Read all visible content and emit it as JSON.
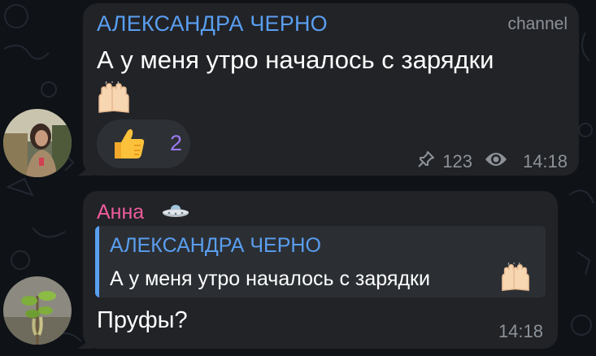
{
  "messages": [
    {
      "author": "АЛЕКСАНДРА ЧЕРНО",
      "tag": "channel",
      "text": "А у меня утро началось с зарядки",
      "emoji": "raising-hands",
      "reaction": {
        "emoji": "thumbs-up",
        "count": "2"
      },
      "views": "123",
      "time": "14:18",
      "pinned": true,
      "avatar": "avatar-woman"
    },
    {
      "author": "Анна",
      "author_badge": "ufo-icon",
      "reply": {
        "author": "АЛЕКСАНДРА ЧЕРНО",
        "text": "А у меня утро началось с зарядки",
        "emoji": "raising-hands"
      },
      "text": "Пруфы?",
      "time": "14:18",
      "avatar": "avatar-plant"
    }
  ],
  "colors": {
    "background": "#0f1217",
    "bubble": "#212327",
    "author_blue": "#5a9ef0",
    "author_pink": "#ee5c9c",
    "reaction_count": "#9b7bf0",
    "meta_gray": "#8d9299"
  }
}
